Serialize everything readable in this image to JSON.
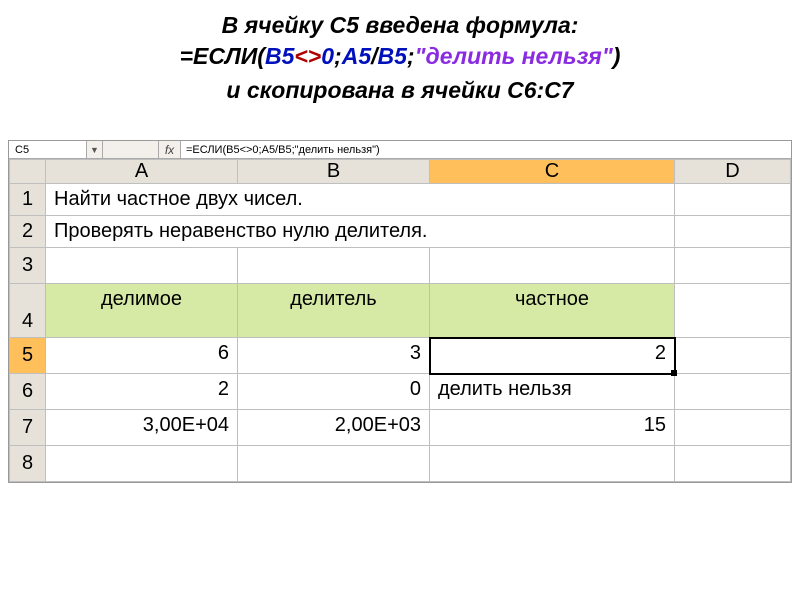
{
  "header": {
    "title": "В ячейку С5 введена формула:",
    "formula_parts": {
      "eq": "=",
      "func": "ЕСЛИ",
      "op_paren_l": "(",
      "ref1": "В5",
      "op_ne": "<>",
      "num0": "0",
      "sep1": ";",
      "ref2": "А5",
      "op_div": "/",
      "ref3": "В5",
      "sep2": ";",
      "str": "\"делить нельзя\"",
      "op_paren_r": ")"
    },
    "subtitle": "и скопирована в ячейки С6:С7"
  },
  "formula_bar": {
    "name_box": "C5",
    "fx_label": "fx",
    "formula_text": "=ЕСЛИ(B5<>0;A5/B5;\"делить нельзя\")"
  },
  "columns": {
    "A": "A",
    "B": "B",
    "C": "C",
    "D": "D"
  },
  "rows": {
    "r1": "1",
    "r2": "2",
    "r3": "3",
    "r4": "4",
    "r5": "5",
    "r6": "6",
    "r7": "7",
    "r8": "8"
  },
  "cells": {
    "A1": "Найти частное двух чисел.",
    "A2": "Проверять неравенство нулю делителя.",
    "A4": "делимое",
    "B4": "делитель",
    "C4": "частное",
    "A5": "6",
    "B5": "3",
    "C5": "2",
    "A6": "2",
    "B6": "0",
    "C6": "делить нельзя",
    "A7": "3,00E+04",
    "B7": "2,00E+03",
    "C7": "15"
  }
}
